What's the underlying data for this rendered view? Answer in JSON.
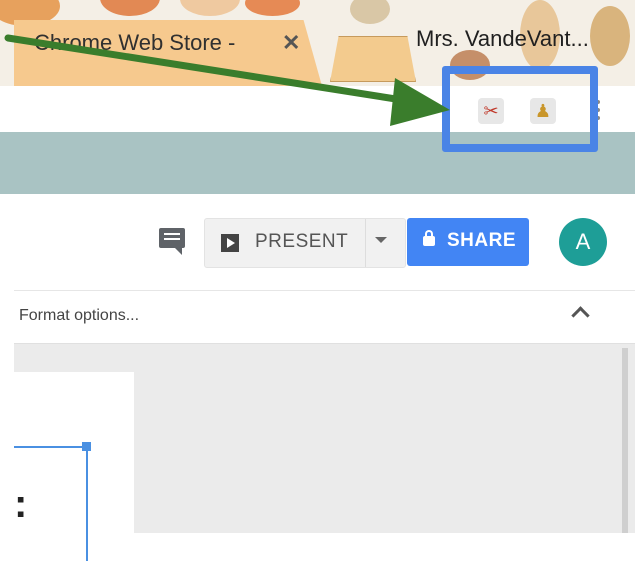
{
  "browser": {
    "tabs": [
      {
        "title": "Chrome Web Store - ",
        "active": true,
        "close_glyph": "✕"
      },
      {
        "title": "Mrs. VandeVant..."
      }
    ],
    "extensions": [
      {
        "name": "scissors-extension-icon",
        "glyph": "✂"
      },
      {
        "name": "stamp-extension-icon",
        "glyph": "♟"
      }
    ]
  },
  "app": {
    "present_label": "PRESENT",
    "share_label": "SHARE",
    "avatar_letter": "A",
    "format_options_label": "Format options...",
    "slide_glyph": ":"
  },
  "colors": {
    "highlight": "#4a84e6",
    "arrow": "#3a7d2c",
    "share": "#4285f4",
    "avatar": "#1e9e97",
    "bookmark_bar": "#a9c3c3"
  }
}
